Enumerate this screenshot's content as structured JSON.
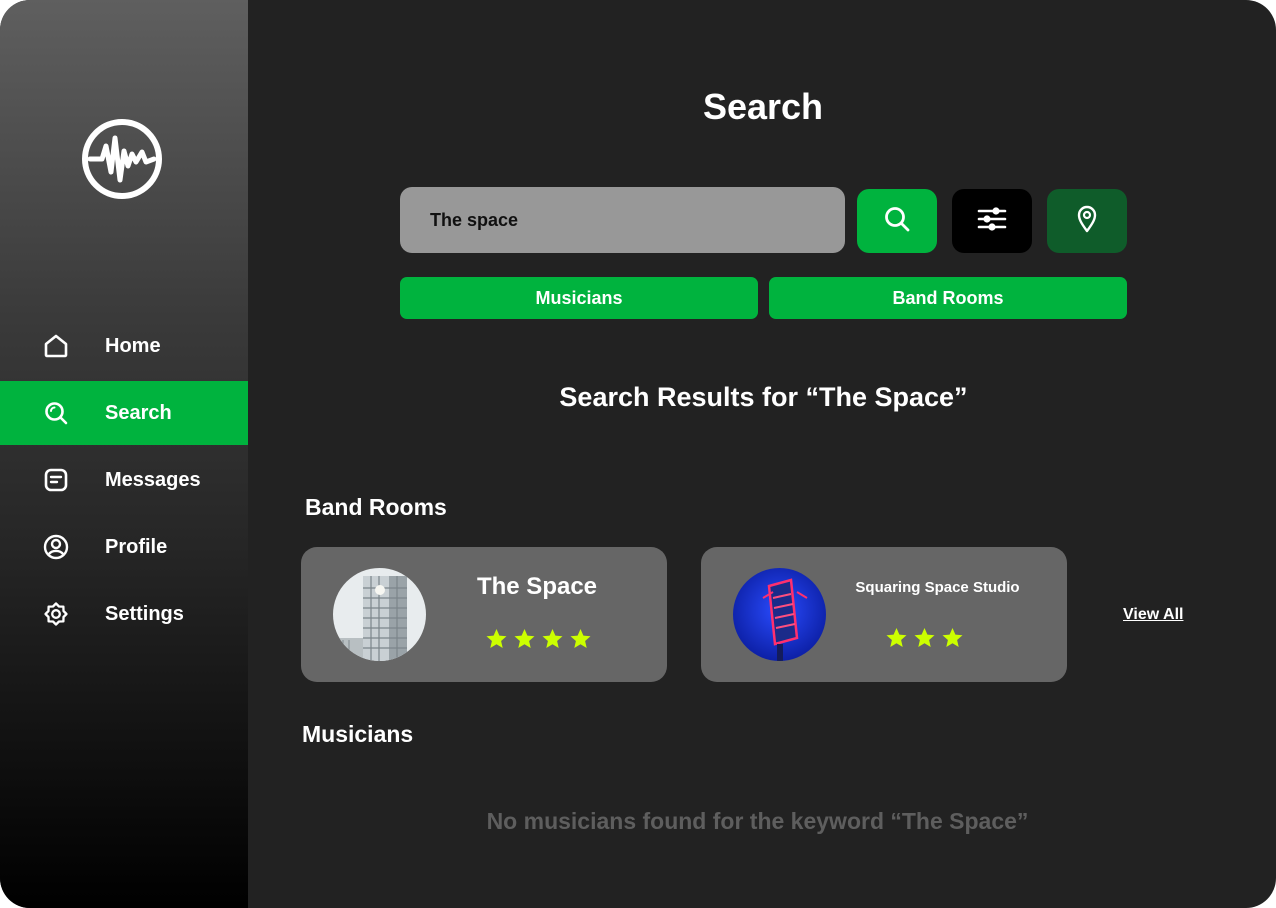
{
  "sidebar": {
    "logo_icon": "soundwave-logo-icon",
    "items": [
      {
        "label": "Home",
        "icon": "home-icon",
        "active": false
      },
      {
        "label": "Search",
        "icon": "search-icon",
        "active": true
      },
      {
        "label": "Messages",
        "icon": "message-icon",
        "active": false
      },
      {
        "label": "Profile",
        "icon": "user-circle-icon",
        "active": false
      },
      {
        "label": "Settings",
        "icon": "gear-icon",
        "active": false
      }
    ]
  },
  "main": {
    "title": "Search",
    "search": {
      "value": "The space",
      "placeholder": ""
    },
    "actions": [
      "search-icon",
      "filter-sliders-icon",
      "location-pin-icon"
    ],
    "tabs": [
      {
        "label": "Musicians"
      },
      {
        "label": "Band Rooms"
      }
    ],
    "results_heading": "Search Results for “The Space”",
    "band_rooms": {
      "heading": "Band Rooms",
      "cards": [
        {
          "name": "The Space",
          "rating": 4
        },
        {
          "name": "Squaring Space Studio",
          "rating": 3
        }
      ],
      "view_all": "View All"
    },
    "musicians": {
      "heading": "Musicians",
      "empty_message": "No musicians found for the keyword “The Space”"
    }
  },
  "colors": {
    "accent": "#00b33e",
    "dark_green": "#0f5c2a",
    "star": "#ccff00",
    "background": "#222222",
    "card": "#666666"
  }
}
